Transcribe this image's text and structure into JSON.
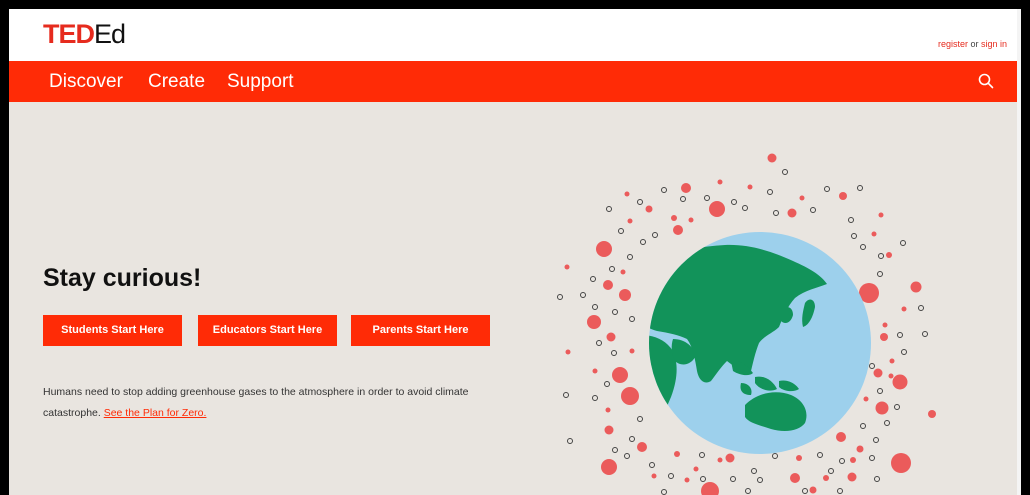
{
  "header": {
    "logo_ted": "TED",
    "logo_ed": "Ed",
    "register_label": "register",
    "or_label": " or ",
    "sign_in_label": "sign in"
  },
  "nav": {
    "items": [
      {
        "label": "Discover"
      },
      {
        "label": "Create"
      },
      {
        "label": "Support"
      }
    ],
    "search_icon": "search-icon"
  },
  "hero": {
    "headline": "Stay curious!",
    "buttons": [
      {
        "label": "Students Start Here"
      },
      {
        "label": "Educators Start Here"
      },
      {
        "label": "Parents Start Here"
      }
    ],
    "blurb_text": "Humans need to stop adding greenhouse gases to the atmosphere in order to avoid climate catastrophe. ",
    "blurb_link": "See the Plan for Zero."
  },
  "colors": {
    "brand_red": "#ff2b06",
    "logo_red": "#e62b1e",
    "background": "#e9e5e0",
    "ocean": "#9dd0ec",
    "land": "#12935a",
    "dot": "#eb5b5b"
  }
}
